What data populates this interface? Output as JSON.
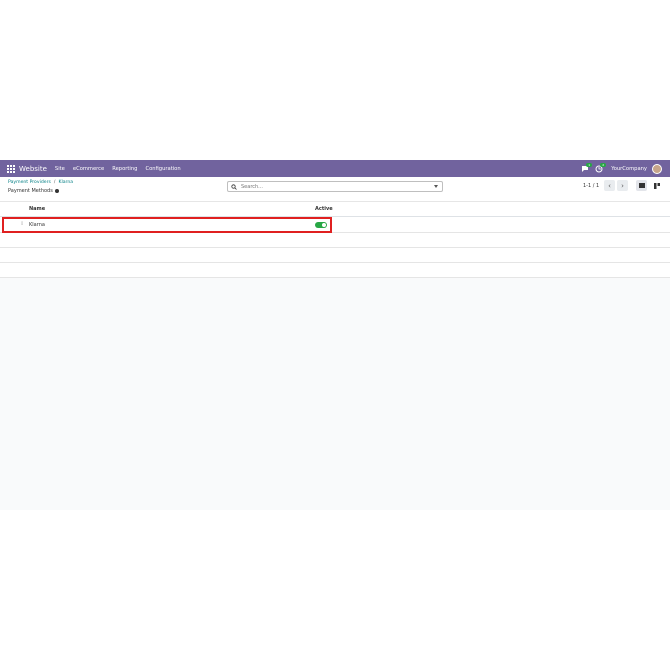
{
  "navbar": {
    "app_name": "Website",
    "menu": [
      "Site",
      "eCommerce",
      "Reporting",
      "Configuration"
    ],
    "messages_badge": "1",
    "activity_badge": "2",
    "company": "YourCompany"
  },
  "breadcrumb": {
    "parent": "Payment Providers",
    "separator": "/",
    "current": "Klarna"
  },
  "page_title": "Payment Methods",
  "search": {
    "placeholder": "Search..."
  },
  "pager": {
    "text": "1-1 / 1"
  },
  "list": {
    "columns": [
      "Name",
      "Active"
    ],
    "rows": [
      {
        "name": "Klarna",
        "active": true
      }
    ]
  },
  "colors": {
    "navbar": "#71639e",
    "toggle_on": "#28a745",
    "highlight": "#e02020",
    "link": "#017e84"
  }
}
